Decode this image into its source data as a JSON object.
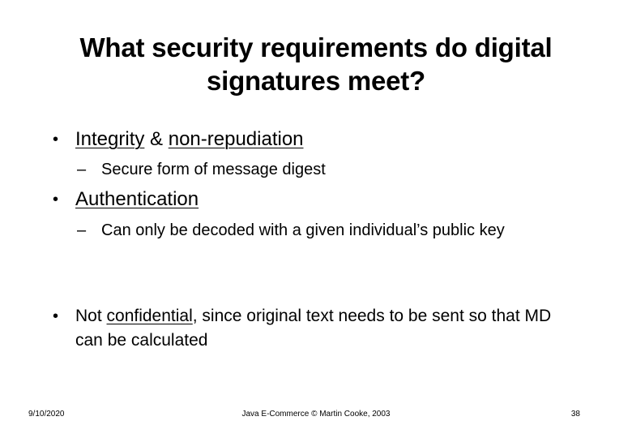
{
  "slide": {
    "title_line1": "What security requirements do digital",
    "title_line2": "signatures meet?",
    "bullets": [
      {
        "marker": "•",
        "segments": [
          {
            "text": "Integrity",
            "underline": true
          },
          {
            "text": " & ",
            "underline": false
          },
          {
            "text": "non-repudiation",
            "underline": true
          }
        ],
        "sub": {
          "marker": "–",
          "text": "Secure form of message digest"
        }
      },
      {
        "marker": "•",
        "segments": [
          {
            "text": "Authentication",
            "underline": true
          }
        ],
        "sub": {
          "marker": "–",
          "text": "Can only be decoded with a given individual’s public key"
        }
      },
      {
        "marker": "•",
        "segments": [
          {
            "text": "Not ",
            "underline": false
          },
          {
            "text": "confidential",
            "underline": true
          },
          {
            "text": ", since original text needs to be sent so that MD can be calculated",
            "underline": false
          }
        ]
      }
    ]
  },
  "footer": {
    "date": "9/10/2020",
    "credit": "Java E-Commerce © Martin Cooke, 2003",
    "page_number": "38"
  }
}
